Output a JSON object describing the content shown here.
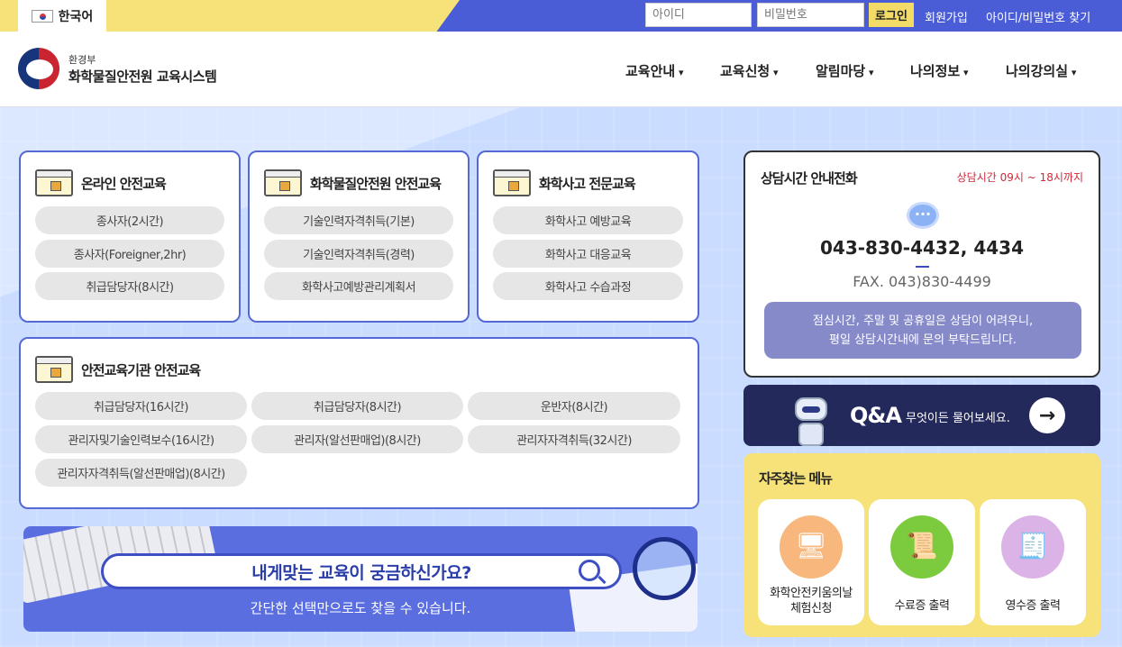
{
  "topbar": {
    "language": "한국어",
    "id_placeholder": "아이디",
    "pw_placeholder": "비밀번호",
    "login": "로그인",
    "signup": "회원가입",
    "find_account": "아이디/비밀번호 찾기"
  },
  "header": {
    "ministry": "환경부",
    "site_title": "화학물질안전원 교육시스템",
    "nav": [
      "교육안내",
      "교육신청",
      "알림마당",
      "나의정보",
      "나의강의실"
    ]
  },
  "courses": {
    "online": {
      "title": "온라인 안전교육",
      "items": [
        "종사자(2시간)",
        "종사자(Foreigner,2hr)",
        "취급담당자(8시간)"
      ]
    },
    "institute": {
      "title": "화학물질안전원 안전교육",
      "items": [
        "기술인력자격취득(기본)",
        "기술인력자격취득(경력)",
        "화학사고예방관리계획서"
      ]
    },
    "accident": {
      "title": "화학사고 전문교육",
      "items": [
        "화학사고 예방교육",
        "화학사고 대응교육",
        "화학사고 수습과정"
      ]
    },
    "agency": {
      "title": "안전교육기관 안전교육",
      "items": [
        "취급담당자(16시간)",
        "취급담당자(8시간)",
        "운반자(8시간)",
        "관리자및기술인력보수(16시간)",
        "관리자(알선판매업)(8시간)",
        "관리자자격취득(32시간)",
        "관리자자격취득(알선판매업)(8시간)"
      ]
    }
  },
  "banner": {
    "headline": "내게맞는 교육이 궁금하신가요?",
    "subtext": "간단한 선택만으로도 찾을 수 있습니다."
  },
  "contact": {
    "title": "상담시간 안내전화",
    "hours": "상담시간 09시 ~ 18시까지",
    "phone": "043-830-4432, 4434",
    "fax": "FAX. 043)830-4499",
    "notice_line1": "점심시간, 주말 및 공휴일은 상담이 어려우니,",
    "notice_line2": "평일 상담시간내에 문의 부탁드립니다."
  },
  "qna": {
    "title": "Q&A",
    "subtitle": "무엇이든 물어보세요."
  },
  "frequent": {
    "title": "자주찾는 메뉴",
    "items": [
      {
        "line1": "화학안전키움의날",
        "line2": "체험신청",
        "icon": "monitor-icon",
        "color": "#f8b77c"
      },
      {
        "line1": "수료증 출력",
        "line2": "",
        "icon": "certificate-icon",
        "color": "#7ccb3e"
      },
      {
        "line1": "영수증 출력",
        "line2": "",
        "icon": "receipt-icon",
        "color": "#dcb3e6"
      }
    ]
  }
}
